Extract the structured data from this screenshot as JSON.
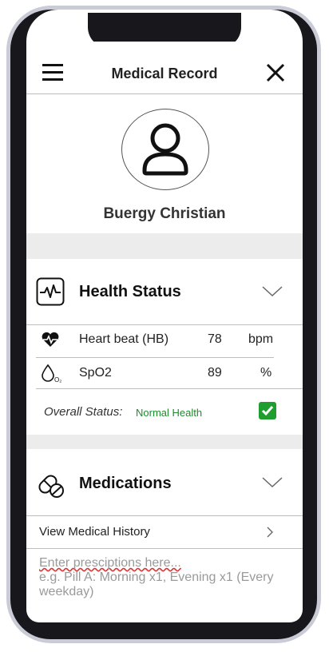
{
  "header": {
    "title": "Medical Record"
  },
  "profile": {
    "name": "Buergy Christian"
  },
  "health_status": {
    "title": "Health Status",
    "rows": [
      {
        "label": "Heart beat (HB)",
        "value": "78",
        "unit": "bpm"
      },
      {
        "label": "SpO2",
        "value": "89",
        "unit": "%"
      }
    ],
    "overall_label": "Overall Status:",
    "overall_value": "Normal Health",
    "status_checked": true
  },
  "medications": {
    "title": "Medications",
    "history_link": "View Medical History",
    "notes_placeholder_line1": "Enter presciptions here...",
    "notes_placeholder_line2": "e.g. Pill A: Morning x1, Evening x1 (Every",
    "notes_placeholder_line3": "weekday)"
  },
  "colors": {
    "accent_green": "#1f9d2e",
    "status_text": "#1f8a2e"
  }
}
